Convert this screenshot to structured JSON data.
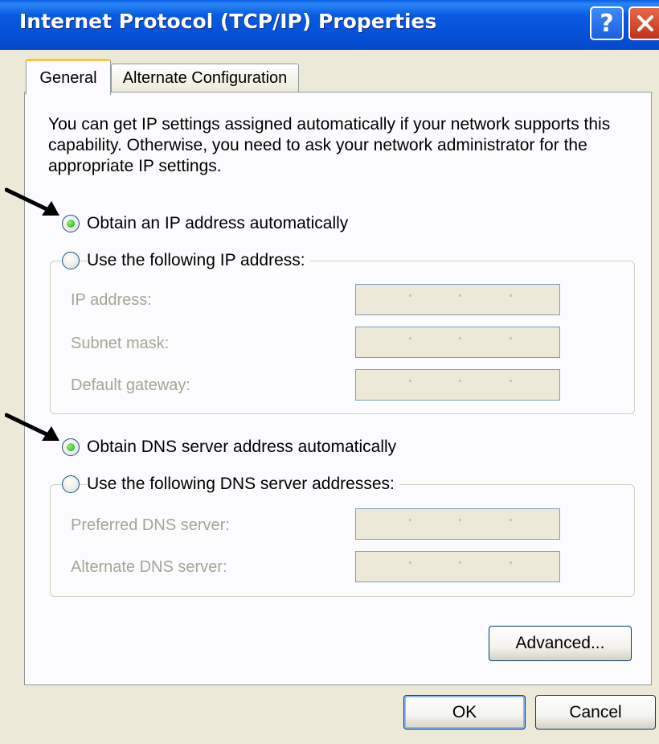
{
  "window": {
    "title": "Internet Protocol (TCP/IP) Properties",
    "help_label": "?",
    "close_icon": "close-icon"
  },
  "tabs": [
    {
      "label": "General",
      "active": true
    },
    {
      "label": "Alternate Configuration",
      "active": false
    }
  ],
  "intro_text": "You can get IP settings assigned automatically if your network supports this capability. Otherwise, you need to ask your network administrator for the appropriate IP settings.",
  "ip": {
    "auto_label": "Obtain an IP address automatically",
    "auto_selected": true,
    "manual_label": "Use the following IP address:",
    "manual_selected": false,
    "fields": [
      {
        "label": "IP address:",
        "value": ""
      },
      {
        "label": "Subnet mask:",
        "value": ""
      },
      {
        "label": "Default gateway:",
        "value": ""
      }
    ]
  },
  "dns": {
    "auto_label": "Obtain DNS server address automatically",
    "auto_selected": true,
    "manual_label": "Use the following DNS server addresses:",
    "manual_selected": false,
    "fields": [
      {
        "label": "Preferred DNS server:",
        "value": ""
      },
      {
        "label": "Alternate DNS server:",
        "value": ""
      }
    ]
  },
  "buttons": {
    "advanced": "Advanced...",
    "ok": "OK",
    "cancel": "Cancel"
  },
  "colors": {
    "titlebar": "#0550d6",
    "dialog_bg": "#ece9d8",
    "tab_highlight": "#ffc83c",
    "radio_selected": "#21a121",
    "disabled_text": "#a6a596"
  }
}
